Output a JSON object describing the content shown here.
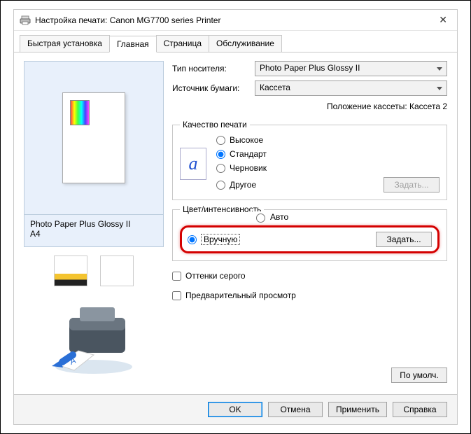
{
  "title": "Настройка печати: Canon MG7700 series Printer",
  "tabs": [
    "Быстрая установка",
    "Главная",
    "Страница",
    "Обслуживание"
  ],
  "active_tab": 1,
  "preview": {
    "label_line1": "Photo Paper Plus Glossy II",
    "label_line2": "A4"
  },
  "media_type": {
    "label": "Тип носителя:",
    "value": "Photo Paper Plus Glossy II"
  },
  "paper_source": {
    "label": "Источник бумаги:",
    "value": "Кассета"
  },
  "cassette_note": "Положение кассеты: Кассета 2",
  "quality": {
    "legend": "Качество печати",
    "options": {
      "high": "Высокое",
      "standard": "Стандарт",
      "draft": "Черновик",
      "other": "Другое"
    },
    "selected": "standard",
    "set_btn": "Задать..."
  },
  "color": {
    "legend": "Цвет/интенсивность",
    "auto": "Авто",
    "manual": "Вручную",
    "selected": "manual",
    "set_btn": "Задать..."
  },
  "grayscale": "Оттенки серого",
  "preview_print": "Предварительный просмотр",
  "defaults_btn": "По умолч.",
  "footer": {
    "ok": "OK",
    "cancel": "Отмена",
    "apply": "Применить",
    "help": "Справка"
  }
}
